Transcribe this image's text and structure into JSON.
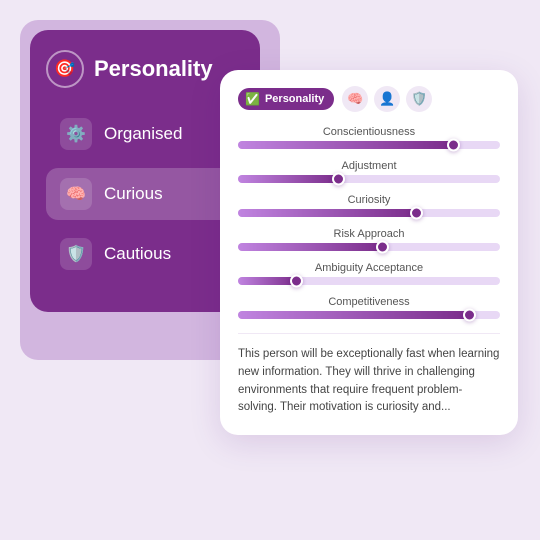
{
  "background": {
    "color": "#f0e8f5"
  },
  "leftCard": {
    "title": "Personality",
    "headerIcon": "🎯",
    "menuItems": [
      {
        "id": "organised",
        "label": "Organised",
        "icon": "⚙️",
        "active": false
      },
      {
        "id": "curious",
        "label": "Curious",
        "icon": "🧠",
        "active": true
      },
      {
        "id": "cautious",
        "label": "Cautious",
        "icon": "🛡️",
        "active": false
      }
    ]
  },
  "rightCard": {
    "badge": "Personality",
    "badgeIcon": "✅",
    "headerIcons": [
      "🧠",
      "👤",
      "🛡️"
    ],
    "traits": [
      {
        "label": "Conscientiousness",
        "percent": 82
      },
      {
        "label": "Adjustment",
        "percent": 38
      },
      {
        "label": "Curiosity",
        "percent": 68
      },
      {
        "label": "Risk Approach",
        "percent": 55
      },
      {
        "label": "Ambiguity Acceptance",
        "percent": 22
      },
      {
        "label": "Competitiveness",
        "percent": 88
      }
    ],
    "description": "This person will be exceptionally fast when learning new information. They will thrive in challenging environments that require frequent problem-solving. Their motivation is curiosity and..."
  }
}
